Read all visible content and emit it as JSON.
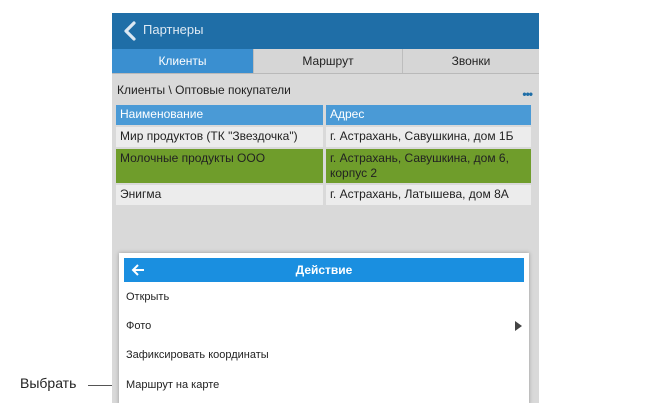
{
  "annotation": {
    "label": "Выбрать"
  },
  "header": {
    "title": "Партнеры"
  },
  "tabs": [
    {
      "label": "Клиенты",
      "active": true
    },
    {
      "label": "Маршрут",
      "active": false
    },
    {
      "label": "Звонки",
      "active": false
    }
  ],
  "breadcrumb": "Клиенты \\ Оптовые покупатели",
  "table": {
    "headers": [
      "Наименование",
      "Адрес"
    ],
    "rows": [
      {
        "name": "Мир продуктов (ТК \"Звездочка\")",
        "address": "г. Астрахань, Савушкина, дом 1Б"
      },
      {
        "name": "Молочные продукты ООО",
        "address": "г. Астрахань, Савушкина, дом 6, корпус 2",
        "highlight": "#6f9d2b"
      },
      {
        "name": "Энигма",
        "address": "г. Астрахань, Латышева, дом 8А"
      }
    ]
  },
  "dialog": {
    "title": "Действие",
    "items": [
      {
        "label": "Открыть"
      },
      {
        "label": "Фото",
        "submenu": true
      },
      {
        "label": "Зафиксировать координаты"
      },
      {
        "label": "Маршрут на карте"
      }
    ]
  },
  "colors": {
    "header_bg": "#1f6ea7",
    "tab_active": "#3a8fd0",
    "table_header": "#4a9ad6",
    "dialog_header": "#1a8fe0"
  },
  "icons": {
    "back": "chevron-left-icon",
    "more": "more-dots-icon",
    "dialog_back": "arrow-left-icon",
    "submenu": "triangle-right-icon"
  }
}
